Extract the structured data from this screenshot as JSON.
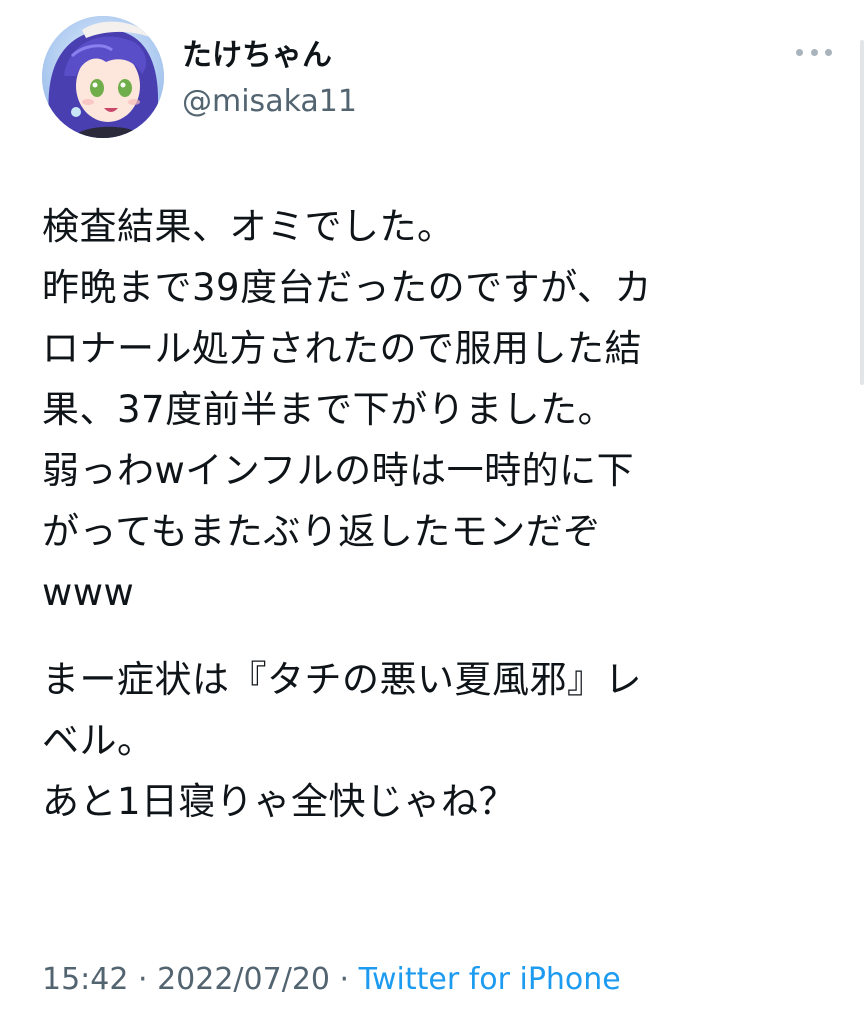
{
  "user": {
    "display_name": "たけちゃん",
    "handle": "@misaka11"
  },
  "icons": {
    "avatar": "avatar-image",
    "more": "more-horizontal-icon"
  },
  "tweet": {
    "lines": [
      "検査結果、オミでした。",
      "昨晩まで39度台だったのですが、カ",
      "ロナール処方されたので服用した結",
      "果、37度前半まで下がりました。",
      "弱っわwインフルの時は一時的に下",
      "がってもまたぶり返したモンだぞ",
      "www",
      "",
      "まー症状は『タチの悪い夏風邪』レ",
      "ベル。",
      "あと1日寝りゃ全快じゃね？"
    ]
  },
  "meta": {
    "time": "15:42",
    "sep1": " · ",
    "date": "2022/07/20",
    "sep2": " · ",
    "source": "Twitter for iPhone"
  },
  "colors": {
    "text": "#0f1419",
    "secondary": "#536471",
    "link": "#1d9bf0"
  }
}
